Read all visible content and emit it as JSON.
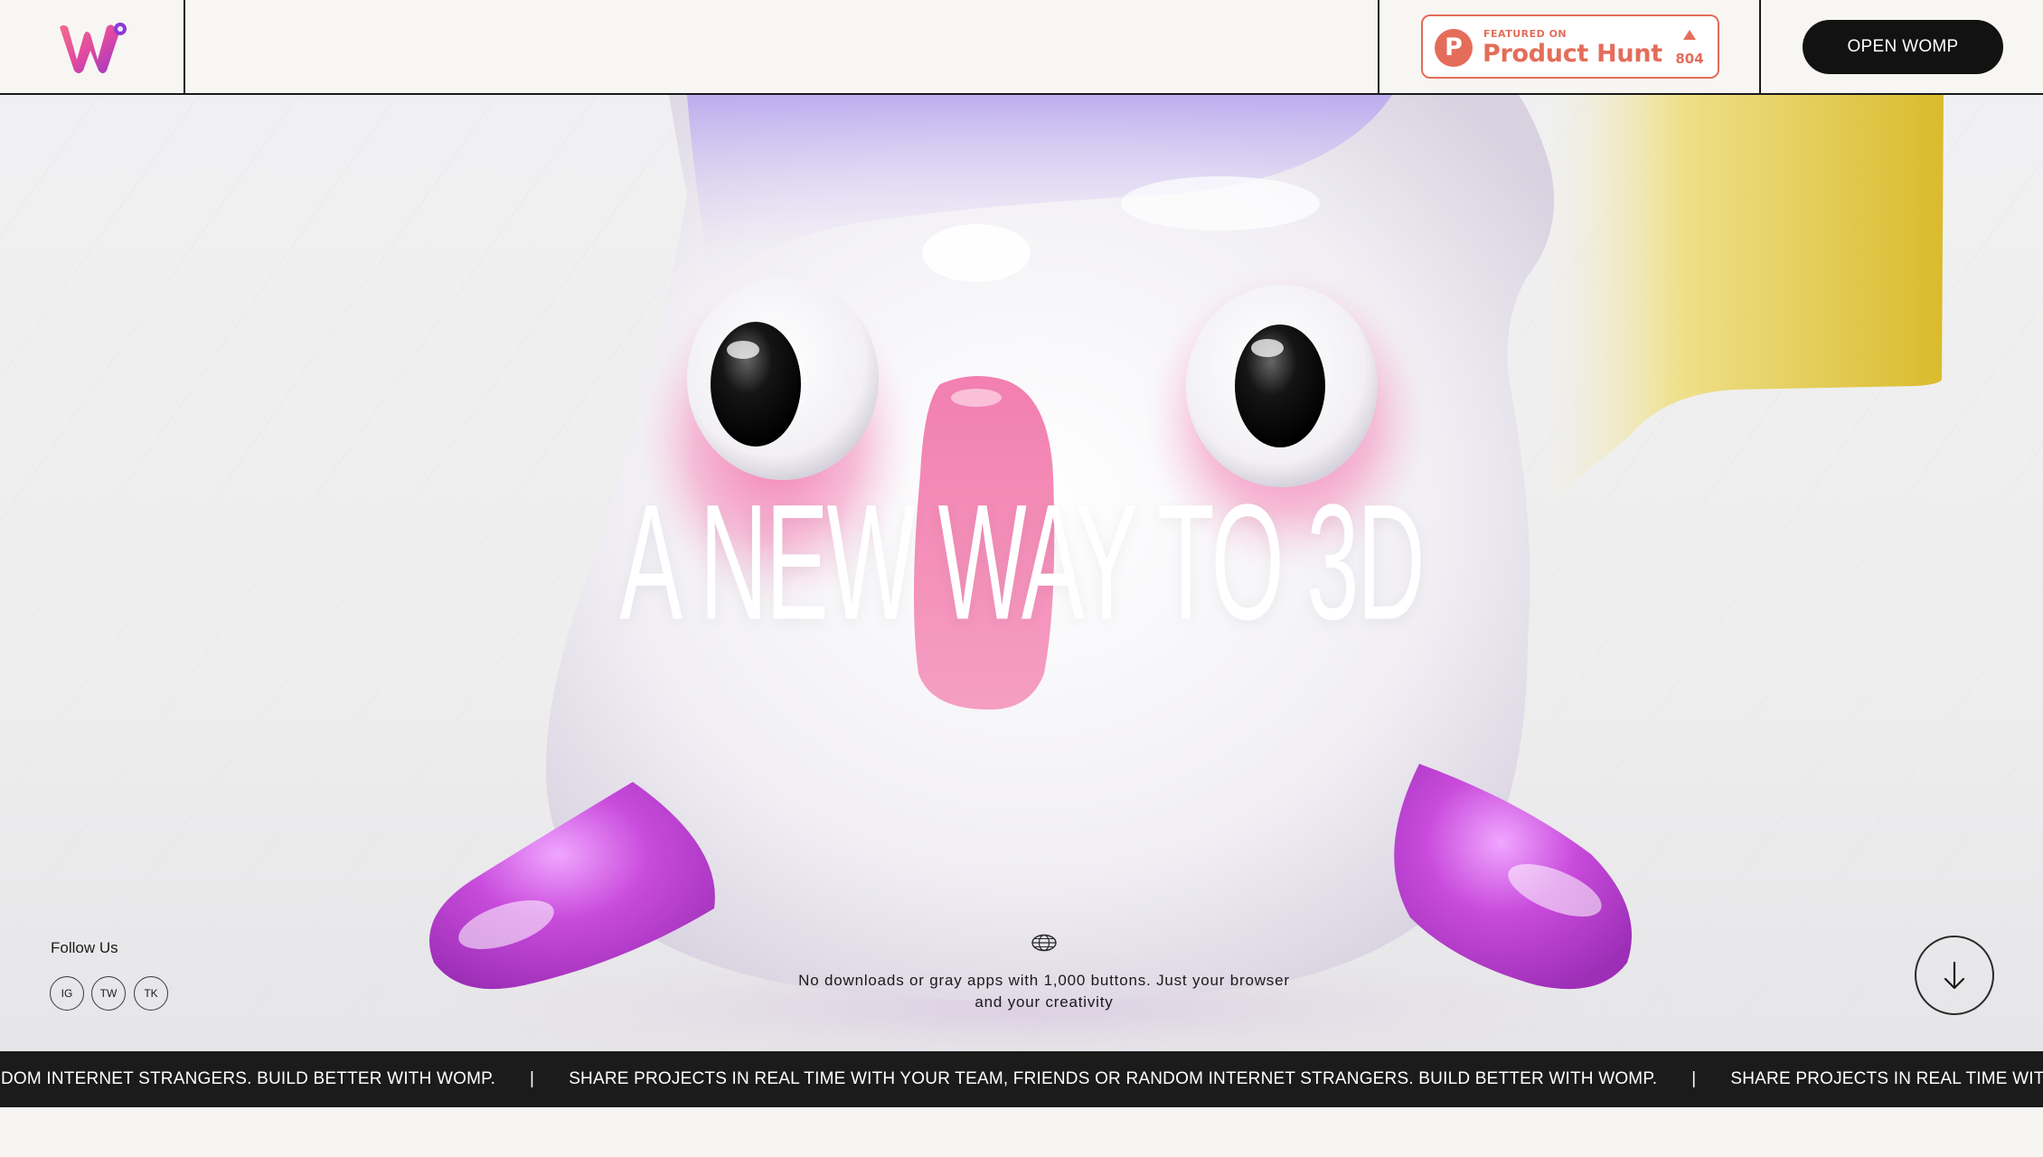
{
  "header": {
    "logo_name": "womp-logo",
    "product_hunt": {
      "featured_label": "FEATURED ON",
      "name": "Product Hunt",
      "letter": "P",
      "upvotes": "804"
    },
    "open_button": "OPEN WOMP"
  },
  "hero": {
    "headline": "A NEW WAY TO 3D",
    "tagline": "No downloads or gray apps with 1,000 buttons. Just your browser and your creativity",
    "follow": {
      "label": "Follow Us",
      "links": [
        "IG",
        "TW",
        "TK"
      ]
    }
  },
  "marquee": {
    "text": "SHARE PROJECTS IN REAL TIME WITH YOUR TEAM, FRIENDS OR RANDOM INTERNET STRANGERS. BUILD BETTER WITH WOMP.",
    "separator": "|"
  },
  "colors": {
    "accent": "#e46d5a",
    "dark": "#121212",
    "background": "#f6f5f2",
    "yellow": "#e2c94a",
    "magenta": "#c24ad6"
  }
}
